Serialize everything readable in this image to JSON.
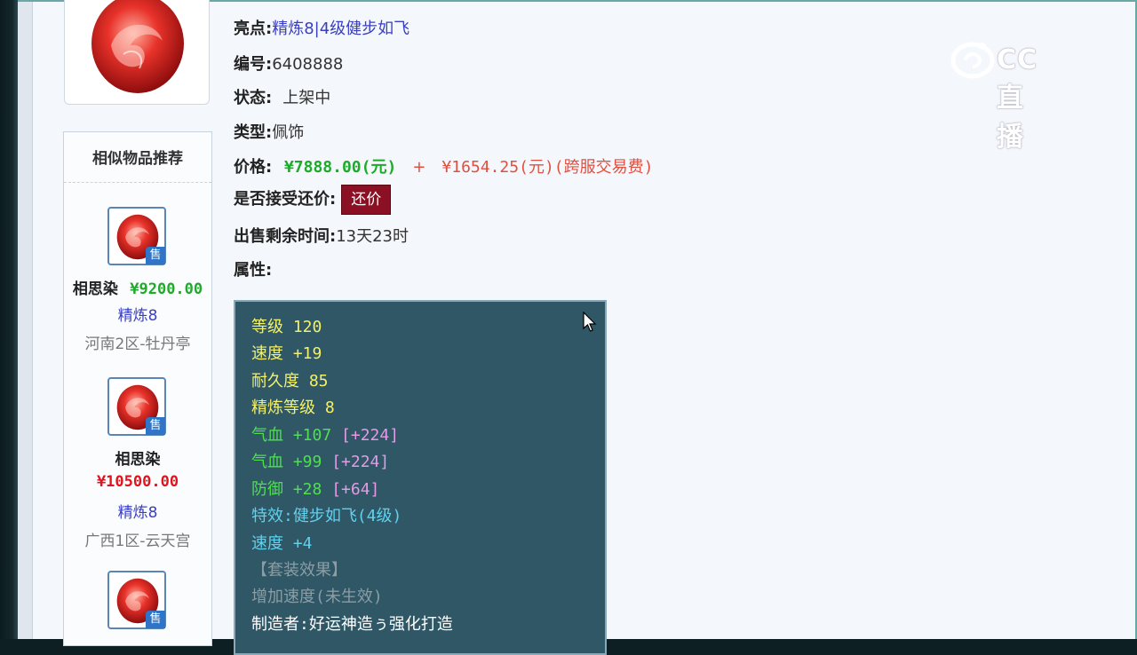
{
  "detail": {
    "highlight_label": "亮点:",
    "highlight_value": "精炼8|4级健步如飞",
    "id_label": "编号:",
    "id_value": "6408888",
    "status_label": "状态:",
    "status_value": "上架中",
    "type_label": "类型:",
    "type_value": "佩饰",
    "price_label": "价格:",
    "price_value": "¥7888.00(元)",
    "price_plus": "+",
    "fee_value": "¥1654.25(元)(跨服交易费)",
    "bargain_label": "是否接受还价:",
    "bargain_button": "还价",
    "time_label": "出售剩余时间:",
    "time_value": "13天23时",
    "attr_label": "属性:"
  },
  "attributes": [
    {
      "text": "等级 120",
      "color": "yellow"
    },
    {
      "text": "速度 +19",
      "color": "yellow"
    },
    {
      "text": "耐久度 85",
      "color": "yellow"
    },
    {
      "text": "精炼等级 8",
      "color": "yellow"
    },
    {
      "text": "气血 +107",
      "extra": "[+224]",
      "color": "green"
    },
    {
      "text": "气血 +99",
      "extra": "[+224]",
      "color": "green"
    },
    {
      "text": "防御 +28",
      "extra": "[+64]",
      "color": "green"
    },
    {
      "text": "特效:健步如飞(4级)",
      "color": "cyan"
    },
    {
      "text": "速度 +4",
      "color": "cyan"
    },
    {
      "text": "【套装效果】",
      "color": "gray"
    },
    {
      "text": "增加速度(未生效)",
      "color": "gray"
    },
    {
      "text": "制造者:好运神造ぅ强化打造",
      "color": "white"
    }
  ],
  "similar": {
    "title": "相似物品推荐",
    "sale_badge": "售",
    "items": [
      {
        "name": "相思染",
        "price": "¥9200.00",
        "refine": "精炼8",
        "server": "河南2区-牡丹亭"
      },
      {
        "name": "相思染",
        "price": "¥10500.00",
        "refine": "精炼8",
        "server": "广西1区-云天宫"
      },
      {
        "name": "",
        "price": "",
        "refine": "",
        "server": ""
      }
    ]
  },
  "watermark": {
    "text": "CC直播"
  },
  "colors": {
    "attr_bg": "#2f5766",
    "price_green": "#1eaa2a",
    "price_red": "#e0141e",
    "bargain_bg": "#8c1023",
    "link_blue": "#3a3fc0"
  }
}
